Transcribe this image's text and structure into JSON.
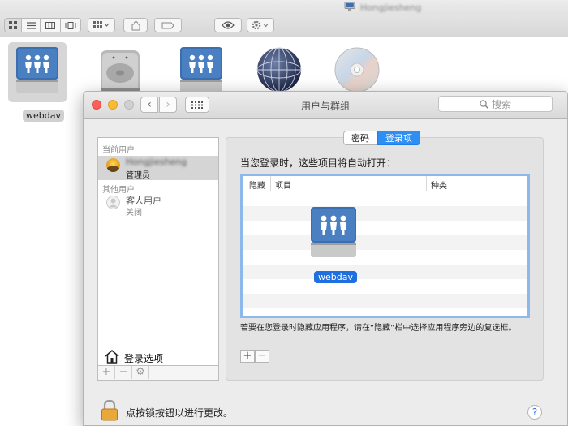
{
  "finder": {
    "computer_name": "Hongjiesheng",
    "icons": [
      {
        "name": "webdav",
        "type": "network-share",
        "selected": true
      },
      {
        "name": "",
        "type": "hard-drive"
      },
      {
        "name": "",
        "type": "network-share"
      },
      {
        "name": "",
        "type": "network-globe"
      },
      {
        "name": "",
        "type": "optical-disc"
      }
    ],
    "selected_icon_label": "webdav"
  },
  "window": {
    "title": "用户与群组",
    "search_placeholder": "搜索",
    "nav_back": "‹",
    "nav_forward": "›"
  },
  "sidebar": {
    "current_users_label": "当前用户",
    "current_user": {
      "name": "Hongjiesheng",
      "role": "管理员"
    },
    "other_users_label": "其他用户",
    "guest_user": {
      "name": "客人用户",
      "status": "关闭"
    },
    "login_options_label": "登录选项",
    "footer_buttons": [
      "+",
      "−",
      "⚙"
    ]
  },
  "tabs": [
    {
      "label": "密码",
      "active": false
    },
    {
      "label": "登录项",
      "active": true
    }
  ],
  "login_items": {
    "heading": "当您登录时，这些项目将自动打开：",
    "columns": [
      "隐藏",
      "项目",
      "种类"
    ],
    "rows": [],
    "drag_item_label": "webdav",
    "hint": "若要在您登录时隐藏应用程序，请在“隐藏”栏中选择应用程序旁边的复选框。",
    "add_button": "+",
    "remove_button": "−"
  },
  "footer": {
    "lock_text": "点按锁按钮以进行更改。",
    "help_label": "?"
  },
  "colors": {
    "accent": "#2d8ef3",
    "selection_blue": "#1e6fe0",
    "table_focus_ring": "#8db8ec"
  }
}
